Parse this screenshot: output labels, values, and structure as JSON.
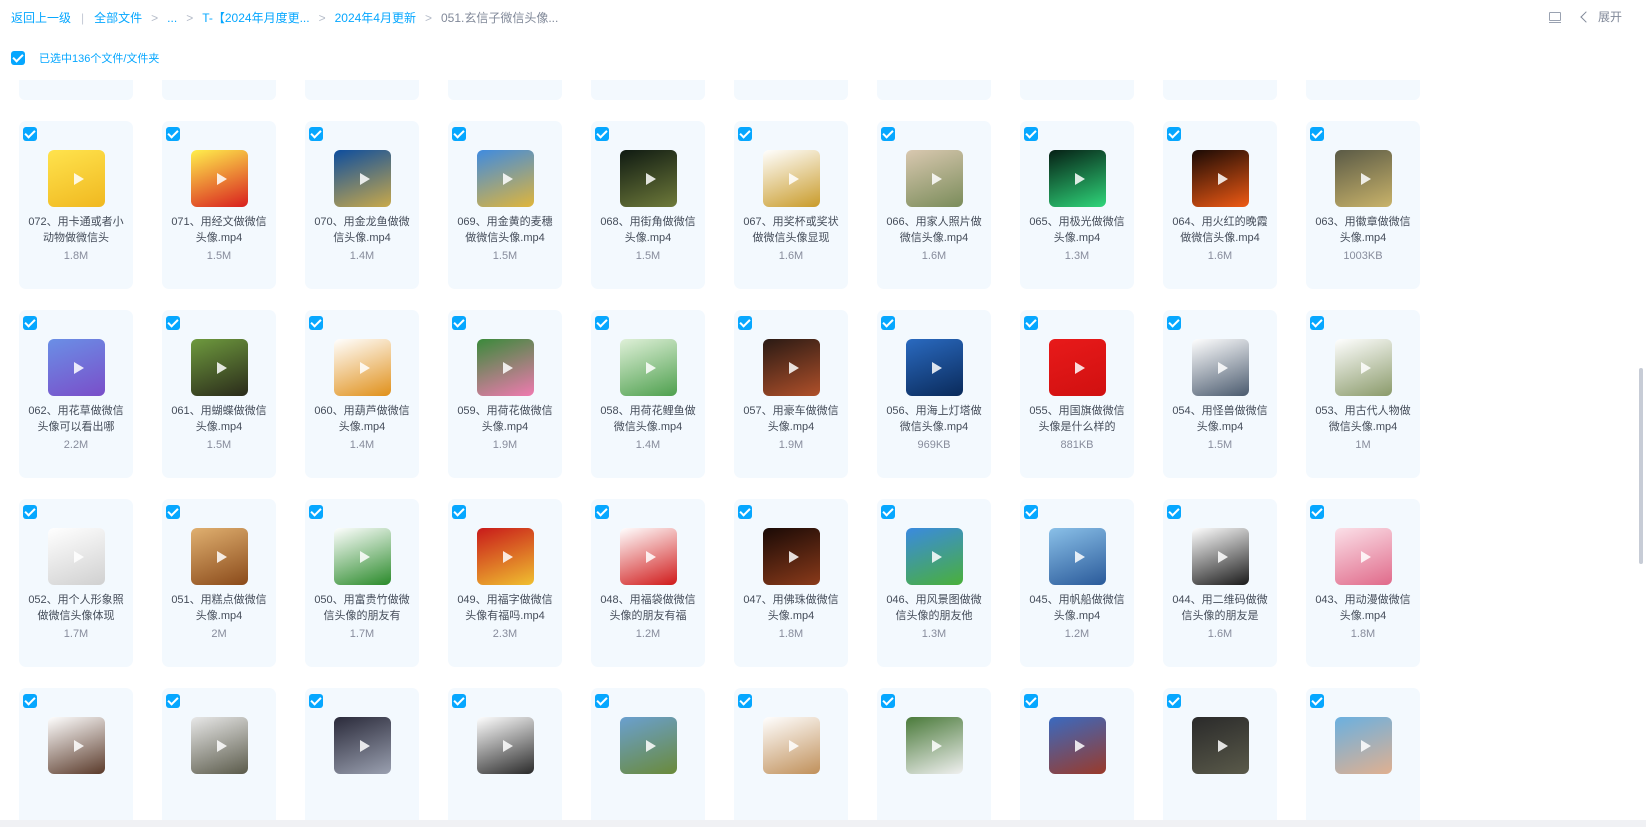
{
  "breadcrumb": {
    "back": "返回上一级",
    "items": [
      "全部文件",
      "...",
      "T-【2024年月度更...",
      "2024年4月更新",
      "051.玄信子微信头像..."
    ]
  },
  "top_right": {
    "expand_label": "展开",
    "icon": "layout-icon"
  },
  "selection": {
    "label": "已选中136个文件/文件夹"
  },
  "colors": {
    "accent": "#06a7ff",
    "card_bg": "#f3f9fe"
  },
  "rows": [
    [
      {
        "name": "072、用卡通或者小动物做微信头",
        "size": "1.8M",
        "thumb": [
          "#ffe34d",
          "#f0b820"
        ]
      },
      {
        "name": "071、用经文做微信头像.mp4",
        "size": "1.5M",
        "thumb": [
          "#fff04d",
          "#d81e1e"
        ]
      },
      {
        "name": "070、用金龙鱼做微信头像.mp4",
        "size": "1.4M",
        "thumb": [
          "#0d4d9e",
          "#c9a94a"
        ]
      },
      {
        "name": "069、用金黄的麦穗做微信头像.mp4",
        "size": "1.5M",
        "thumb": [
          "#3f8be0",
          "#e0b53a"
        ]
      },
      {
        "name": "068、用街角做微信头像.mp4",
        "size": "1.5M",
        "thumb": [
          "#0f1a12",
          "#6e7a3a"
        ]
      },
      {
        "name": "067、用奖杯或奖状做微信头像显现",
        "size": "1.6M",
        "thumb": [
          "#ffffff",
          "#c99b2a"
        ]
      },
      {
        "name": "066、用家人照片做微信头像.mp4",
        "size": "1.6M",
        "thumb": [
          "#d9c8b0",
          "#7a8c5a"
        ]
      },
      {
        "name": "065、用极光做微信头像.mp4",
        "size": "1.3M",
        "thumb": [
          "#062015",
          "#2fd67a"
        ]
      },
      {
        "name": "064、用火红的晚霞做微信头像.mp4",
        "size": "1.6M",
        "thumb": [
          "#1a0a05",
          "#f05a14"
        ]
      },
      {
        "name": "063、用徽章做微信头像.mp4",
        "size": "1003KB",
        "thumb": [
          "#5a5a46",
          "#c9b36a"
        ]
      }
    ],
    [
      {
        "name": "062、用花草做微信头像可以看出哪",
        "size": "2.2M",
        "thumb": [
          "#6a8fe6",
          "#7a4ec9"
        ]
      },
      {
        "name": "061、用蝴蝶做微信头像.mp4",
        "size": "1.5M",
        "thumb": [
          "#6e9a3e",
          "#2a2a1a"
        ]
      },
      {
        "name": "060、用葫芦做微信头像.mp4",
        "size": "1.4M",
        "thumb": [
          "#ffffff",
          "#e0901a"
        ]
      },
      {
        "name": "059、用荷花做微信头像.mp4",
        "size": "1.9M",
        "thumb": [
          "#3a8a3a",
          "#f07ab0"
        ]
      },
      {
        "name": "058、用荷花鲤鱼做微信头像.mp4",
        "size": "1.4M",
        "thumb": [
          "#dff0d8",
          "#4ea04e"
        ]
      },
      {
        "name": "057、用豪车做微信头像.mp4",
        "size": "1.9M",
        "thumb": [
          "#2a1a14",
          "#b0502a"
        ]
      },
      {
        "name": "056、用海上灯塔做微信头像.mp4",
        "size": "969KB",
        "thumb": [
          "#2a6ac0",
          "#0a2a5a"
        ]
      },
      {
        "name": "055、用国旗做微信头像是什么样的",
        "size": "881KB",
        "thumb": [
          "#e81a1a",
          "#d01010"
        ]
      },
      {
        "name": "054、用怪兽做微信头像.mp4",
        "size": "1.5M",
        "thumb": [
          "#ffffff",
          "#4a5a6e"
        ]
      },
      {
        "name": "053、用古代人物做微信头像.mp4",
        "size": "1M",
        "thumb": [
          "#ffffff",
          "#8a9a6a"
        ]
      }
    ],
    [
      {
        "name": "052、用个人形象照做微信头像体现",
        "size": "1.7M",
        "thumb": [
          "#ffffff",
          "#d0d0d0"
        ]
      },
      {
        "name": "051、用糕点做微信头像.mp4",
        "size": "2M",
        "thumb": [
          "#e0b070",
          "#8a4a1a"
        ]
      },
      {
        "name": "050、用富贵竹做微信头像的朋友有",
        "size": "1.7M",
        "thumb": [
          "#ffffff",
          "#2a8a2a"
        ]
      },
      {
        "name": "049、用福字做微信头像有福吗.mp4",
        "size": "2.3M",
        "thumb": [
          "#c81a1a",
          "#f0c030"
        ]
      },
      {
        "name": "048、用福袋做微信头像的朋友有福",
        "size": "1.2M",
        "thumb": [
          "#ffffff",
          "#d01a1a"
        ]
      },
      {
        "name": "047、用佛珠做微信头像.mp4",
        "size": "1.8M",
        "thumb": [
          "#1a0a06",
          "#8a3a1a"
        ]
      },
      {
        "name": "046、用风景图做微信头像的朋友他",
        "size": "1.3M",
        "thumb": [
          "#3a8ae0",
          "#4ab03a"
        ]
      },
      {
        "name": "045、用帆船做微信头像.mp4",
        "size": "1.2M",
        "thumb": [
          "#8ac0e8",
          "#2a5a9a"
        ]
      },
      {
        "name": "044、用二维码做微信头像的朋友是",
        "size": "1.6M",
        "thumb": [
          "#ffffff",
          "#1a1a1a"
        ]
      },
      {
        "name": "043、用动漫做微信头像.mp4",
        "size": "1.8M",
        "thumb": [
          "#fbe0e8",
          "#e06a8a"
        ]
      }
    ],
    [
      {
        "name": "",
        "size": "",
        "thumb": [
          "#ffffff",
          "#5a3a2a"
        ]
      },
      {
        "name": "",
        "size": "",
        "thumb": [
          "#e8e8e8",
          "#5a5a4a"
        ]
      },
      {
        "name": "",
        "size": "",
        "thumb": [
          "#2a2a3a",
          "#9aa0b0"
        ]
      },
      {
        "name": "",
        "size": "",
        "thumb": [
          "#ffffff",
          "#2a2a2a"
        ]
      },
      {
        "name": "",
        "size": "",
        "thumb": [
          "#6aa0d0",
          "#6a8a3a"
        ]
      },
      {
        "name": "",
        "size": "",
        "thumb": [
          "#ffffff",
          "#c0905a"
        ]
      },
      {
        "name": "",
        "size": "",
        "thumb": [
          "#4a7a3a",
          "#f0f0f0"
        ]
      },
      {
        "name": "",
        "size": "",
        "thumb": [
          "#3a6ac0",
          "#9a3a2a"
        ]
      },
      {
        "name": "",
        "size": "",
        "thumb": [
          "#2a2a2a",
          "#5a5a4a"
        ]
      },
      {
        "name": "",
        "size": "",
        "thumb": [
          "#6ab0e0",
          "#e0b090"
        ]
      }
    ]
  ]
}
